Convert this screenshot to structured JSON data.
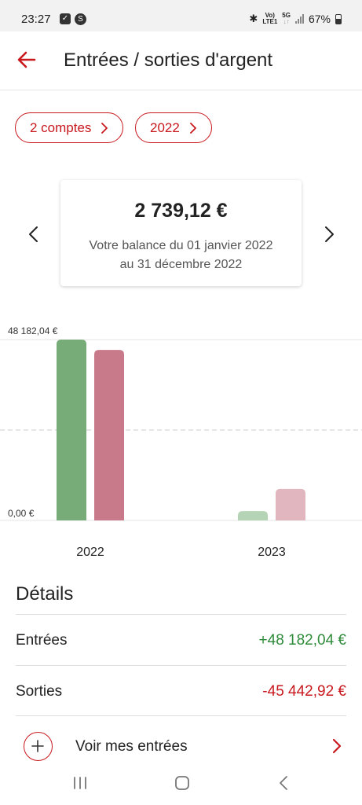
{
  "status_bar": {
    "time": "23:27",
    "battery": "67%",
    "network_top": "Vo)",
    "network_bottom": "LTE1",
    "gen_top": "5G",
    "gen_bottom": "↓↑"
  },
  "header": {
    "title": "Entrées / sorties d'argent"
  },
  "filters": {
    "accounts_label": "2 comptes",
    "year_label": "2022"
  },
  "balance": {
    "amount": "2 739,12 €",
    "caption_line1": "Votre balance du 01 janvier 2022",
    "caption_line2": "au 31 décembre 2022"
  },
  "colors": {
    "accent": "#c8181e",
    "income": "#2e8b3a",
    "expense": "#c8181e",
    "bar_income": "#77ab78",
    "bar_expense": "#c87a8a",
    "bar_income_faded": "#b5d3b5",
    "bar_expense_faded": "#e2b6bf"
  },
  "chart_data": {
    "type": "bar",
    "categories": [
      "2022",
      "2023"
    ],
    "series": [
      {
        "name": "Entrées",
        "values": [
          48182.04,
          2500
        ]
      },
      {
        "name": "Sorties",
        "values": [
          45442.92,
          8400
        ]
      }
    ],
    "ylim": [
      0,
      48182.04
    ],
    "y_ticks": [
      "48 182,04 €",
      "0,00 €"
    ],
    "selected_category": "2022",
    "mid_dashed_line": true
  },
  "details": {
    "title": "Détails",
    "rows": [
      {
        "label": "Entrées",
        "value": "+48 182,04 €"
      },
      {
        "label": "Sorties",
        "value": "-45 442,92 €"
      }
    ],
    "voir_label": "Voir mes entrées"
  },
  "icons": {
    "back": "back-arrow-icon",
    "prev": "chevron-left-icon",
    "next": "chevron-right-icon",
    "plus": "plus-circle-icon"
  }
}
